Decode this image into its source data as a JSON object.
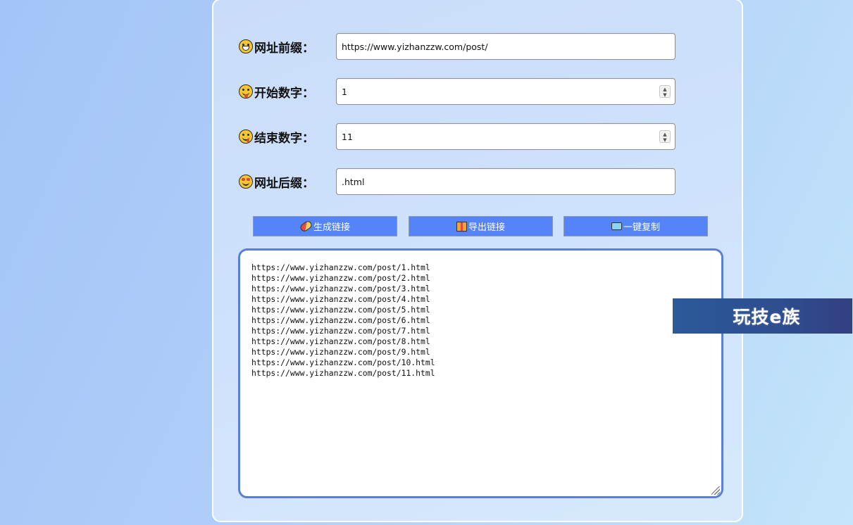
{
  "form": {
    "prefix": {
      "label": "网址前缀：",
      "icon": "grinning-face-icon",
      "value": "https://www.yizhanzzw.com/post/"
    },
    "start": {
      "label": "开始数字：",
      "icon": "tongue-face-icon",
      "value": "1"
    },
    "end": {
      "label": "结束数字：",
      "icon": "yum-face-icon",
      "value": "11"
    },
    "suffix": {
      "label": "网址后缀：",
      "icon": "heart-eyes-face-icon",
      "value": ".html"
    }
  },
  "buttons": {
    "generate": {
      "label": "生成链接",
      "icon": "pill-icon"
    },
    "export": {
      "label": "导出链接",
      "icon": "gift-icon"
    },
    "copy": {
      "label": "一键复制",
      "icon": "clipboard-icon"
    }
  },
  "output": {
    "text": "https://www.yizhanzzw.com/post/1.html\nhttps://www.yizhanzzw.com/post/2.html\nhttps://www.yizhanzzw.com/post/3.html\nhttps://www.yizhanzzw.com/post/4.html\nhttps://www.yizhanzzw.com/post/5.html\nhttps://www.yizhanzzw.com/post/6.html\nhttps://www.yizhanzzw.com/post/7.html\nhttps://www.yizhanzzw.com/post/8.html\nhttps://www.yizhanzzw.com/post/9.html\nhttps://www.yizhanzzw.com/post/10.html\nhttps://www.yizhanzzw.com/post/11.html"
  },
  "watermark": {
    "text": "玩技e族"
  },
  "colors": {
    "button_bg": "#5484f8",
    "output_border": "#5a7fd6",
    "watermark_bg": "#2e4d8e"
  }
}
